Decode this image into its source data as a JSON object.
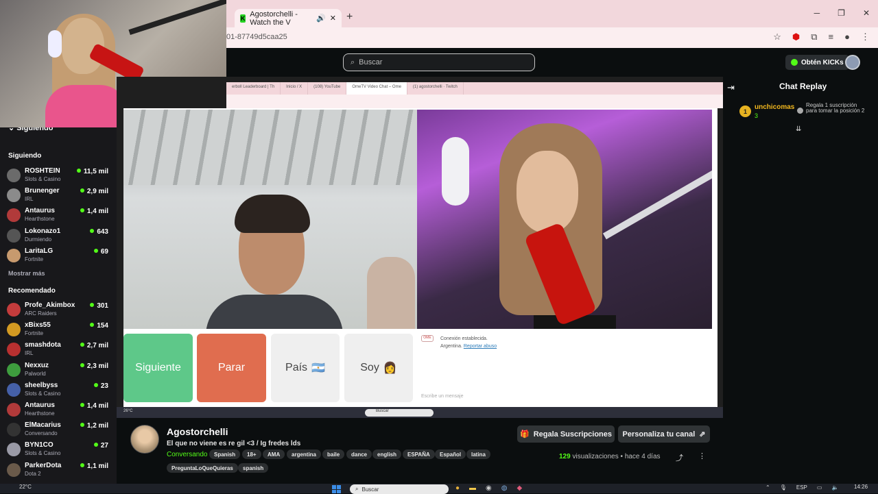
{
  "browser": {
    "tab_title": "Agostorchelli - Watch the V",
    "url_partial": "01-87749d5caa25",
    "new_tab": "+",
    "tab_icon": "K"
  },
  "kick_header": {
    "search_placeholder": "Buscar",
    "kicks_button": "Obtén KICKs"
  },
  "sidebar": {
    "top_label": "Siguiendo",
    "following_header": "Siguiendo",
    "following": [
      {
        "name": "ROSHTEIN",
        "category": "Slots & Casino",
        "viewers": "11,5 mil",
        "color": "#6b6b6b"
      },
      {
        "name": "Brunenger",
        "category": "IRL",
        "viewers": "2,9 mil",
        "color": "#8b8b8b"
      },
      {
        "name": "Antaurus",
        "category": "Hearthstone",
        "viewers": "1,4 mil",
        "color": "#b13a3a"
      },
      {
        "name": "Lokonazo1",
        "category": "Durmiendo",
        "viewers": "643",
        "color": "#555"
      },
      {
        "name": "LaritaLG",
        "category": "Fortnite",
        "viewers": "69",
        "color": "#c79a6e"
      }
    ],
    "show_more": "Mostrar más",
    "recommended_header": "Recomendado",
    "recommended": [
      {
        "name": "Profe_Akimbox",
        "category": "ARC Raiders",
        "viewers": "301",
        "color": "#c43c3c"
      },
      {
        "name": "xBixs55",
        "category": "Fortnite",
        "viewers": "154",
        "color": "#d39a22"
      },
      {
        "name": "smashdota",
        "category": "IRL",
        "viewers": "2,7 mil",
        "color": "#b83030"
      },
      {
        "name": "Nexxuz",
        "category": "Palworld",
        "viewers": "2,3 mil",
        "color": "#3e9d3e"
      },
      {
        "name": "sheelbyss",
        "category": "Slots & Casino",
        "viewers": "23",
        "color": "#4560a8"
      },
      {
        "name": "Antaurus",
        "category": "Hearthstone",
        "viewers": "1,4 mil",
        "color": "#b13a3a"
      },
      {
        "name": "ElMacarius",
        "category": "Conversando",
        "viewers": "1,2 mil",
        "color": "#333"
      },
      {
        "name": "BYN1CO",
        "category": "Slots & Casino",
        "viewers": "27",
        "color": "#9a9aa6"
      },
      {
        "name": "ParkerDota",
        "category": "Dota 2",
        "viewers": "1,1 mil",
        "color": "#6a5a4a"
      }
    ]
  },
  "stream": {
    "inner_tabs": [
      "erboll Leaderboard | Th",
      "Inicio / X",
      "(108) YouTube",
      "OmeTV Video Chat – Ome",
      "(1) agostorchelli · Twitch"
    ],
    "buttons": {
      "next": "Siguiente",
      "stop": "Parar",
      "country": "País",
      "country_flag": "🇦🇷",
      "iam": "Soy",
      "iam_emoji": "👩"
    },
    "system_message": {
      "line1": "Conexión establecida.",
      "line2": "Argentina.",
      "report": "Reportar abuso"
    },
    "input_placeholder": "Escribe un mensaje",
    "inner_search": "Buscar",
    "inner_weather": "26°C"
  },
  "channel": {
    "name": "Agostorchelli",
    "title": "El que no viene es re gil <3 / Ig fredes lds",
    "status": "Conversando",
    "tags": [
      "Spanish",
      "18+",
      "AMA",
      "argentina",
      "baile",
      "dance",
      "english",
      "ESPAÑA",
      "Español",
      "latina",
      "PreguntaLoQueQuieras",
      "spanish"
    ],
    "gift_button": "Regala Suscripciones",
    "customize_button": "Personaliza tu canal",
    "view_count": "129",
    "views_label": "visualizaciones",
    "time_ago": "hace 4 días"
  },
  "chat": {
    "title": "Chat Replay",
    "message": {
      "badge": "1",
      "user": "unchicomas",
      "sub_count": "3",
      "text": "Regala 1 suscripción para tomar la posición 2"
    }
  },
  "taskbar": {
    "weather": "22°C",
    "search": "Buscar",
    "language": "ESP",
    "time": "14:26"
  }
}
